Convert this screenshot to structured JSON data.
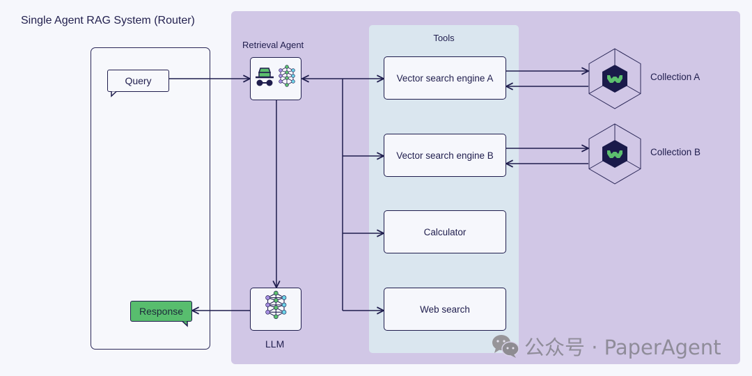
{
  "title": "Single Agent RAG System (Router)",
  "agent": {
    "label": "Retrieval Agent",
    "icons": [
      "incognito-agent-icon",
      "neural-network-icon"
    ]
  },
  "llm": {
    "label": "LLM",
    "icon": "neural-network-icon"
  },
  "query": {
    "label": "Query"
  },
  "response": {
    "label": "Response"
  },
  "tools": {
    "title": "Tools",
    "items": [
      {
        "label": "Vector search engine A"
      },
      {
        "label": "Vector search engine B"
      },
      {
        "label": "Calculator"
      },
      {
        "label": "Web search"
      }
    ]
  },
  "collections": [
    {
      "label": "Collection A",
      "icon": "weaviate-database-icon"
    },
    {
      "label": "Collection B",
      "icon": "weaviate-database-icon"
    }
  ],
  "watermark": {
    "text": "公众号 · PaperAgent",
    "icon": "wechat-icon"
  },
  "colors": {
    "background": "#f6f7fc",
    "agent_panel": "#d1c7e6",
    "tools_panel": "#dae6ef",
    "stroke": "#1f1d4d",
    "response_green": "#58bd6e",
    "node_green": "#5cbf6e",
    "node_purple": "#a58ee0",
    "node_cyan": "#6dd3e8"
  }
}
